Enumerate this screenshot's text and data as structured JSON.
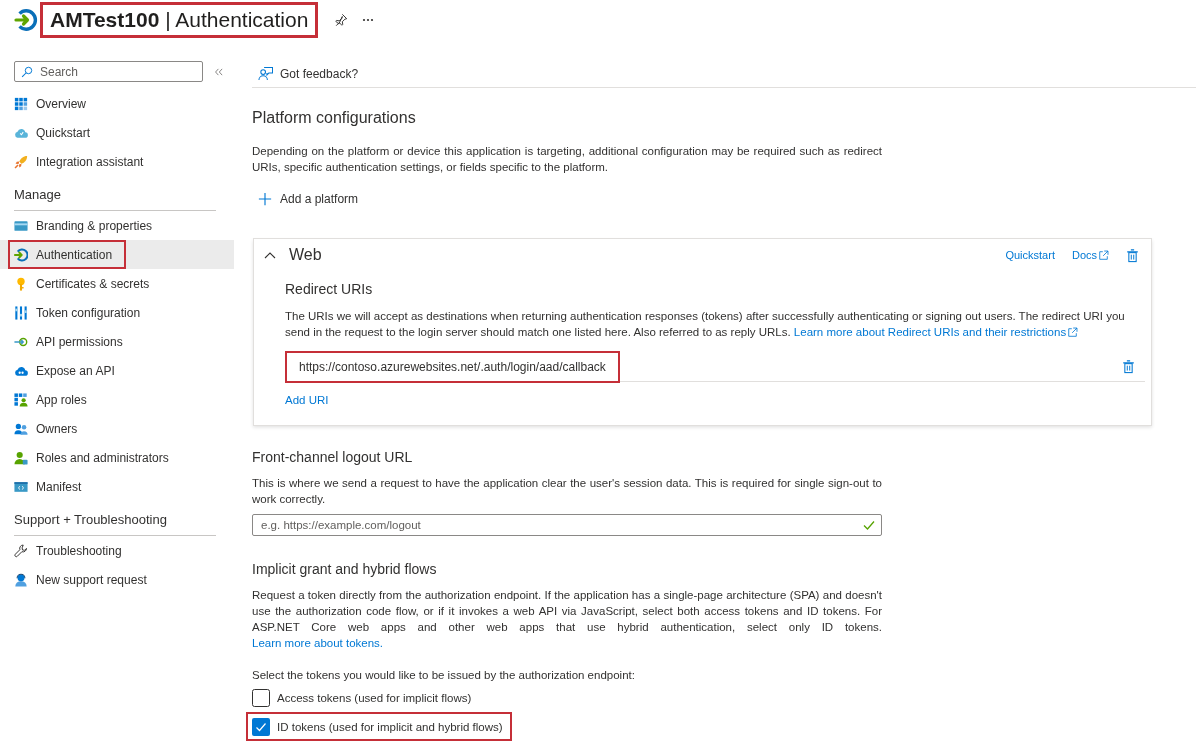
{
  "header": {
    "title": "**AMTest100** | Authentication",
    "highlighted": true
  },
  "sidebar": {
    "search": {
      "placeholder": "Search"
    },
    "sections": [
      {
        "items": [
          {
            "label": "Overview",
            "selected": false,
            "highlighted": false
          },
          {
            "label": "Quickstart",
            "selected": false,
            "highlighted": false
          },
          {
            "label": "Integration assistant",
            "selected": false,
            "highlighted": false
          }
        ]
      },
      {
        "title": "Manage",
        "items": [
          {
            "label": "Branding & properties",
            "selected": false,
            "highlighted": false
          },
          {
            "label": "Authentication",
            "selected": true,
            "highlighted": true
          },
          {
            "label": "Certificates & secrets",
            "selected": false,
            "highlighted": false
          },
          {
            "label": "Token configuration",
            "selected": false,
            "highlighted": false
          },
          {
            "label": "API permissions",
            "selected": false,
            "highlighted": false
          },
          {
            "label": "Expose an API",
            "selected": false,
            "highlighted": false
          },
          {
            "label": "App roles",
            "selected": false,
            "highlighted": false
          },
          {
            "label": "Owners",
            "selected": false,
            "highlighted": false
          },
          {
            "label": "Roles and administrators",
            "selected": false,
            "highlighted": false
          },
          {
            "label": "Manifest",
            "selected": false,
            "highlighted": false
          }
        ]
      },
      {
        "title": "Support + Troubleshooting",
        "items": [
          {
            "label": "Troubleshooting",
            "selected": false,
            "highlighted": false
          },
          {
            "label": "New support request",
            "selected": false,
            "highlighted": false
          }
        ]
      }
    ]
  },
  "toolbar": {
    "feedback": "Got feedback?"
  },
  "platform_configurations": {
    "title": "Platform configurations",
    "description": "Depending on the platform or device this application is targeting, additional configuration may be required such as redirect URIs, specific authentication settings, or fields specific to the platform.",
    "add_button": "Add a platform"
  },
  "web_platform": {
    "title": "Web",
    "expanded": true,
    "quickstart_link": "Quickstart",
    "docs_link": "Docs",
    "redirect_uris": {
      "title": "Redirect URIs",
      "description": "The URIs we will accept as destinations when returning authentication responses (tokens) after successfully authenticating or signing out users. The redirect URI you send in the request to the login server should match one listed here. Also referred to as reply URLs.",
      "link": "Learn more about Redirect URIs and their restrictions",
      "uris": [
        {
          "value": "https://contoso.azurewebsites.net/.auth/login/aad/callback",
          "highlighted": true
        }
      ],
      "add_uri": "Add URI"
    }
  },
  "front_channel_logout": {
    "title": "Front-channel logout URL",
    "description": "This is where we send a request to have the application clear the user's session data. This is required for single sign-out to work correctly.",
    "field": {
      "placeholder": "e.g. https://example.com/logout",
      "valid": true
    }
  },
  "implicit_grant": {
    "title": "Implicit grant and hybrid flows",
    "description": "Request a token directly from the authorization endpoint. If the application has a single-page architecture (SPA) and doesn't use the authorization code flow, or if it invokes a web API via JavaScript, select both access tokens and ID tokens. For ASP.NET Core web apps and other web apps that use hybrid authentication, select only ID tokens.",
    "link": "Learn more about tokens.",
    "prompt": "Select the tokens you would like to be issued by the authorization endpoint:",
    "options": [
      {
        "label": "Access tokens (used for implicit flows)",
        "checked": false,
        "highlighted": false
      },
      {
        "label": "ID tokens (used for implicit and hybrid flows)",
        "checked": true,
        "highlighted": true
      }
    ]
  }
}
